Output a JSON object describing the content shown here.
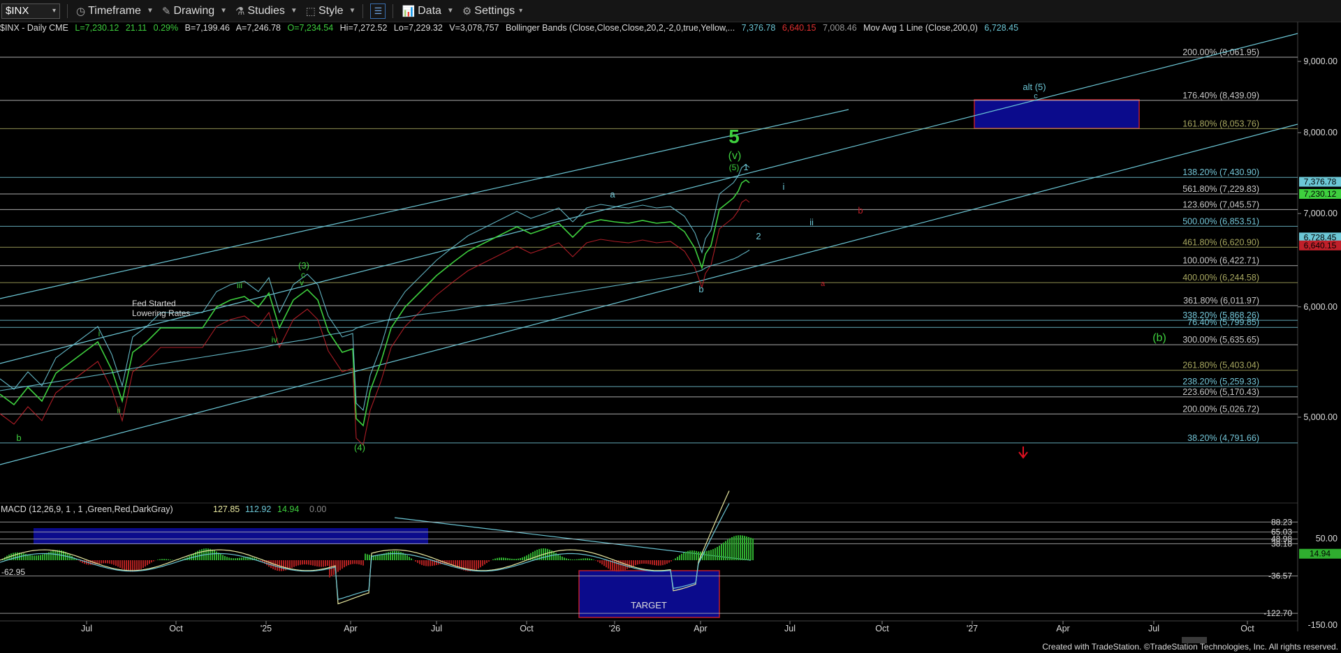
{
  "toolbar": {
    "symbol": "$INX",
    "timeframe": "Timeframe",
    "drawing": "Drawing",
    "studies": "Studies",
    "style": "Style",
    "data": "Data",
    "settings": "Settings"
  },
  "status": {
    "symbol_line": "$INX - Daily  CME",
    "last": "L=7,230.12",
    "change": "21.11",
    "change_pct": "0.29%",
    "bid": "B=7,199.46",
    "ask": "A=7,246.78",
    "open": "O=7,234.54",
    "high": "Hi=7,272.52",
    "low": "Lo=7,229.32",
    "volume": "V=3,078,757",
    "bb_label": "Bollinger Bands (Close,Close,Close,20,2,-2,0,true,Yellow,...",
    "bb_upper": "7,376.78",
    "bb_lower": "6,640.15",
    "bb_mid": "7,008.46",
    "ma_label": "Mov Avg 1 Line (Close,200,0)",
    "ma_value": "6,728.45"
  },
  "colors": {
    "price": "#3ecf3e",
    "cyan": "#6cc7d6",
    "red": "#c0202a",
    "fib_gray": "#c9c9c9",
    "fib_olive": "#a8a860",
    "fib_cyan": "#74c6d8",
    "target_fill": "#0b0b8c",
    "macd_up": "#2fae2f",
    "macd_down": "#b02020"
  },
  "chart_data": {
    "type": "line",
    "title": "$INX - Daily",
    "y_axis": {
      "scale": "log",
      "ticks": [
        "5,000.00",
        "6,000.00",
        "7,000.00",
        "8,000.00",
        "9,000.00"
      ],
      "tick_values": [
        5000,
        6000,
        7000,
        8000,
        9000
      ]
    },
    "x_axis": {
      "ticks": [
        "Jul",
        "Oct",
        "'25",
        "Apr",
        "Jul",
        "Oct",
        "'26",
        "Apr",
        "Jul",
        "Oct",
        "'27",
        "Apr",
        "Jul",
        "Oct"
      ]
    },
    "last_price_label": "7,230.12",
    "price_tags": [
      {
        "text": "7,376.78",
        "value": 7376.78,
        "color": "#6cc7d6"
      },
      {
        "text": "7,230.12",
        "value": 7230.12,
        "color": "#3ecf3e"
      },
      {
        "text": "6,728.45",
        "value": 6728.45,
        "color": "#6cc7d6"
      },
      {
        "text": "6,640.15",
        "value": 6640.15,
        "color": "#c0202a"
      }
    ],
    "fib_levels": [
      {
        "label": "200.00% (9,061.95)",
        "value": 9061.95,
        "color": "#c9c9c9"
      },
      {
        "label": "176.40% (8,439.09)",
        "value": 8439.09,
        "color": "#c9c9c9"
      },
      {
        "label": "161.80% (8,053.76)",
        "value": 8053.76,
        "color": "#a8a860"
      },
      {
        "label": "138.20% (7,430.90)",
        "value": 7430.9,
        "color": "#74c6d8"
      },
      {
        "label": "561.80% (7,229.83)",
        "value": 7229.83,
        "color": "#c9c9c9"
      },
      {
        "label": "123.60% (7,045.57)",
        "value": 7045.57,
        "color": "#c9c9c9"
      },
      {
        "label": "500.00% (6,853.51)",
        "value": 6853.51,
        "color": "#74c6d8"
      },
      {
        "label": "461.80% (6,620.90)",
        "value": 6620.9,
        "color": "#a8a860"
      },
      {
        "label": "100.00% (6,422.71)",
        "value": 6422.71,
        "color": "#c9c9c9"
      },
      {
        "label": "400.00% (6,244.58)",
        "value": 6244.58,
        "color": "#a8a860"
      },
      {
        "label": "361.80% (6,011.97)",
        "value": 6011.97,
        "color": "#c9c9c9"
      },
      {
        "label": "338.20% (5,868.26)",
        "value": 5868.26,
        "color": "#74c6d8"
      },
      {
        "label": "76.40% (5,799.85)",
        "value": 5799.85,
        "color": "#74c6d8"
      },
      {
        "label": "300.00% (5,635.65)",
        "value": 5635.65,
        "color": "#c9c9c9"
      },
      {
        "label": "261.80% (5,403.04)",
        "value": 5403.04,
        "color": "#a8a860"
      },
      {
        "label": "238.20% (5,259.33)",
        "value": 5259.33,
        "color": "#74c6d8"
      },
      {
        "label": "223.60% (5,170.43)",
        "value": 5170.43,
        "color": "#c9c9c9"
      },
      {
        "label": "200.00% (5,026.72)",
        "value": 5026.72,
        "color": "#c9c9c9"
      },
      {
        "label": "38.20% (4,791.66)",
        "value": 4791.66,
        "color": "#74c6d8"
      }
    ],
    "wave_labels": [
      {
        "text": "5",
        "color": "#3ecf3e",
        "big": true
      },
      {
        "text": "(v)",
        "color": "#3ecf3e"
      },
      {
        "text": "(5)",
        "color": "#3ecf3e"
      },
      {
        "text": "1",
        "color": "#6cc7d6"
      },
      {
        "text": "i",
        "color": "#6cc7d6"
      },
      {
        "text": "ii",
        "color": "#6cc7d6"
      },
      {
        "text": "2",
        "color": "#6cc7d6"
      },
      {
        "text": "b",
        "color": "#c0202a"
      },
      {
        "text": "a",
        "color": "#c0202a"
      },
      {
        "text": "a",
        "color": "#6cc7d6"
      },
      {
        "text": "b",
        "color": "#6cc7d6"
      },
      {
        "text": "alt (5)",
        "color": "#6cc7d6"
      },
      {
        "text": "c",
        "color": "#6cc7d6"
      },
      {
        "text": "(b)",
        "color": "#3ecf3e"
      },
      {
        "text": "(3)",
        "color": "#3ecf3e"
      },
      {
        "text": "c",
        "color": "#3ecf3e"
      },
      {
        "text": "v",
        "color": "#3ecf3e"
      },
      {
        "text": "iii",
        "color": "#3ecf3e"
      },
      {
        "text": "iv",
        "color": "#3ecf3e"
      },
      {
        "text": "i",
        "color": "#3ecf3e"
      },
      {
        "text": "ii",
        "color": "#3ecf3e"
      },
      {
        "text": "b",
        "color": "#3ecf3e"
      },
      {
        "text": "(4)",
        "color": "#3ecf3e"
      }
    ],
    "annotation": "Fed Started\nLowering Rates",
    "macd": {
      "label": "MACD (12,26,9, 1 , 1 ,Green,Red,DarkGray)",
      "values": [
        "127.85",
        "112.92",
        "14.94",
        "0.00"
      ],
      "value_colors": [
        "#e8e8a0",
        "#6cc7d6",
        "#3ecf3e",
        "#888888"
      ],
      "left_value": "-62.95",
      "levels": [
        "88.23",
        "65.03",
        "48.98",
        "38.18",
        "-36.57",
        "-122.70"
      ],
      "level_values": [
        88.23,
        65.03,
        48.98,
        38.18,
        -36.57,
        -122.7
      ],
      "axis_ticks": [
        "50.00",
        "-150.00"
      ],
      "axis_tick_values": [
        50,
        -150
      ],
      "current_tag": "14.94",
      "target_label": "TARGET"
    }
  },
  "footer": "Created with TradeStation. ©TradeStation Technologies, Inc. All rights reserved."
}
